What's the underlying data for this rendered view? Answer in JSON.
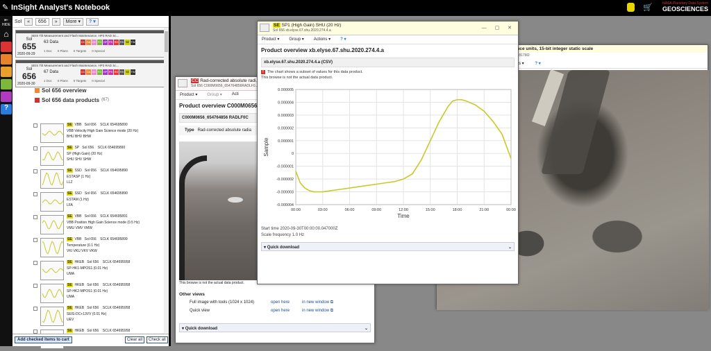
{
  "app": {
    "title": "InSight Analyst's Notebook",
    "brand_pds": "NASA Planetary Data System",
    "brand_geo": "GEOSCIENCES",
    "rail_hide": "HIDE"
  },
  "sidebar": {
    "sol_label": "Sol",
    "sol_value": "656",
    "more": "More",
    "help": "?",
    "cards": [
      {
        "desc": "SEIS Tilt Measurement and Flash Maintenance. HP3 RAD Sc...",
        "sol_word": "Sol",
        "sol": "655",
        "date": "2020-09-29",
        "count": "63 Data",
        "docs": "1 Doc",
        "plans": "0 Plans",
        "targets": "0 Targets",
        "special": "0 Special"
      },
      {
        "desc": "SEIS Tilt Measurement and Flash Maintenance. HP3 RAD Sc...",
        "sol_word": "Sol",
        "sol": "656",
        "date": "2020-09-30",
        "count": "67 Data",
        "docs": "1 Doc",
        "plans": "0 Plans",
        "targets": "0 Targets",
        "special": "0 Special"
      }
    ],
    "overview": "Sol 656 overview",
    "products_hd": "Sol 656 data products",
    "products_count": "(67)",
    "products": [
      {
        "code": "SE",
        "inst": "VBB",
        "sol": "Sol 656",
        "sclk": "SCLK 654695890",
        "name": "VBB Velocity High Gain Science mode (20 Hz)",
        "ch": "BHU BHV BHW"
      },
      {
        "code": "SE",
        "inst": "SP",
        "sol": "Sol 656",
        "sclk": "SCLK 654695890",
        "name": "SP (High Gain) (20 Hz)",
        "ch": "SHU SHV SHW"
      },
      {
        "code": "SE",
        "inst": "SSD",
        "sol": "Sol 656",
        "sclk": "SCLK 654695890",
        "name": "ESTASP (1 Hz)",
        "ch": "LLZ"
      },
      {
        "code": "SE",
        "inst": "SSD",
        "sol": "Sol 656",
        "sclk": "SCLK 654695890",
        "name": "ESTAM (1 Hz)",
        "ch": "LFA"
      },
      {
        "code": "SE",
        "inst": "VBB",
        "sol": "Sol 656",
        "sclk": "SCLK 654695891",
        "name": "VBB Position High Gain Science mode (0.5 Hz)",
        "ch": "VMU VMV VMW"
      },
      {
        "code": "SE",
        "inst": "VBB",
        "sol": "Sol 656",
        "sclk": "SCLK 654695899",
        "name": "Temperature (0.1 Hz)",
        "ch": "VKI VKU VKV VKW"
      },
      {
        "code": "SE",
        "inst": "HKEB",
        "sol": "Sol 656",
        "sclk": "SCLK 654695958",
        "name": "SP-HK1-MPOS1 (0.01 Hz)",
        "ch": "UMA"
      },
      {
        "code": "SE",
        "inst": "HKEB",
        "sol": "Sol 656",
        "sclk": "SCLK 654695958",
        "name": "SP-HK2-MPOS1 (0.01 Hz)",
        "ch": "UMA"
      },
      {
        "code": "SE",
        "inst": "HKEB",
        "sol": "Sol 656",
        "sclk": "SCLK 654695958",
        "name": "SEIS-DC+13VV (0.01 Hz)",
        "ch": "UEV"
      },
      {
        "code": "SE",
        "inst": "HKEB",
        "sol": "Sol 656",
        "sclk": "SCLK 654695958",
        "name": "CAL1-HKT (0.01 Hz)",
        "ch": ""
      }
    ],
    "add_btn": "Add checked items to cart",
    "clear_all": "Clear all",
    "check_all": "Check all"
  },
  "rad_panel": {
    "code": "CC",
    "title": "Rad-corrected absolute radi...",
    "sub": "Sol 656 C000M0656_654764856RADLF0...",
    "menu_product": "Product",
    "menu_group": "Group",
    "menu_actions": "Acti",
    "ov_title": "Product overview C000M0656_",
    "pid": "C000M0656_654764856 RADLF0C",
    "type_label": "Type",
    "type_value": "Rad-corrected absolute radia",
    "note": "This browse is not the actual data product.",
    "other_views": "Other views",
    "full_image": "Full image with tools (1024 x 1024)",
    "quick_view": "Quick view",
    "open_here": "open here",
    "new_window": "in new window",
    "quick_download": "Quick download"
  },
  "shu_panel": {
    "code": "SE",
    "title": "SP1 (High Gain) SHU (20 Hz)",
    "sub": "Sol 656 xb.elyse.67.shu.2020.274.4.a",
    "menu_product": "Product",
    "menu_group": "Group",
    "menu_actions": "Actions",
    "help": "?",
    "ov_title": "Product overview xb.elyse.67.shu.2020.274.4.a",
    "csv": "xb.elyse.67.shu.2020.274.4.a (CSV)",
    "warn1": "The chart shows a subset of values for this data product.",
    "warn2": "This browse is not the actual data product.",
    "start": "Start time 2020-09-30T00:00:00.047000Z",
    "freq": "Scale frequency 1.0 Hz",
    "quick_download": "Quick download"
  },
  "right_panel": {
    "title": "iance units, 15-bit integer static scale",
    "sub": "0_0817M2",
    "menu_actions": "ions",
    "help": "?"
  },
  "chart_data": {
    "type": "line",
    "xlabel": "Time",
    "ylabel": "Sample",
    "x_ticks": [
      "00:00",
      "03:00",
      "06:00",
      "09:00",
      "12:00",
      "15:00",
      "18:00",
      "21:00",
      "00:00"
    ],
    "y_ticks": [
      "0.000005",
      "0.000004",
      "0.000003",
      "0.000002",
      "0.000001",
      "0",
      "-0.000001",
      "-0.000002",
      "-0.000003",
      "-0.000004"
    ],
    "ylim": [
      -4e-06,
      5e-06
    ],
    "x_hours": [
      0,
      0.5,
      1,
      1.5,
      2,
      3,
      4,
      5,
      6,
      7,
      8,
      9,
      10,
      11,
      12,
      13,
      14,
      15,
      16,
      17,
      17.5,
      18,
      18.5,
      19,
      20,
      21,
      22,
      23,
      24
    ],
    "values": [
      -1.4e-06,
      -2.3e-06,
      -2.7e-06,
      -2.9e-06,
      -3e-06,
      -3e-06,
      -2.9e-06,
      -2.8e-06,
      -2.7e-06,
      -2.6e-06,
      -2.5e-06,
      -2.4e-06,
      -2.3e-06,
      -2.2e-06,
      -2e-06,
      -1.6e-06,
      -5e-07,
      1e-06,
      2.5e-06,
      3.7e-06,
      4.1e-06,
      4.2e-06,
      4.2e-06,
      4.1e-06,
      3.8e-06,
      3.3e-06,
      2.5e-06,
      1.5e-06,
      -4e-07
    ],
    "color": "#c9c92a",
    "grid": true
  }
}
